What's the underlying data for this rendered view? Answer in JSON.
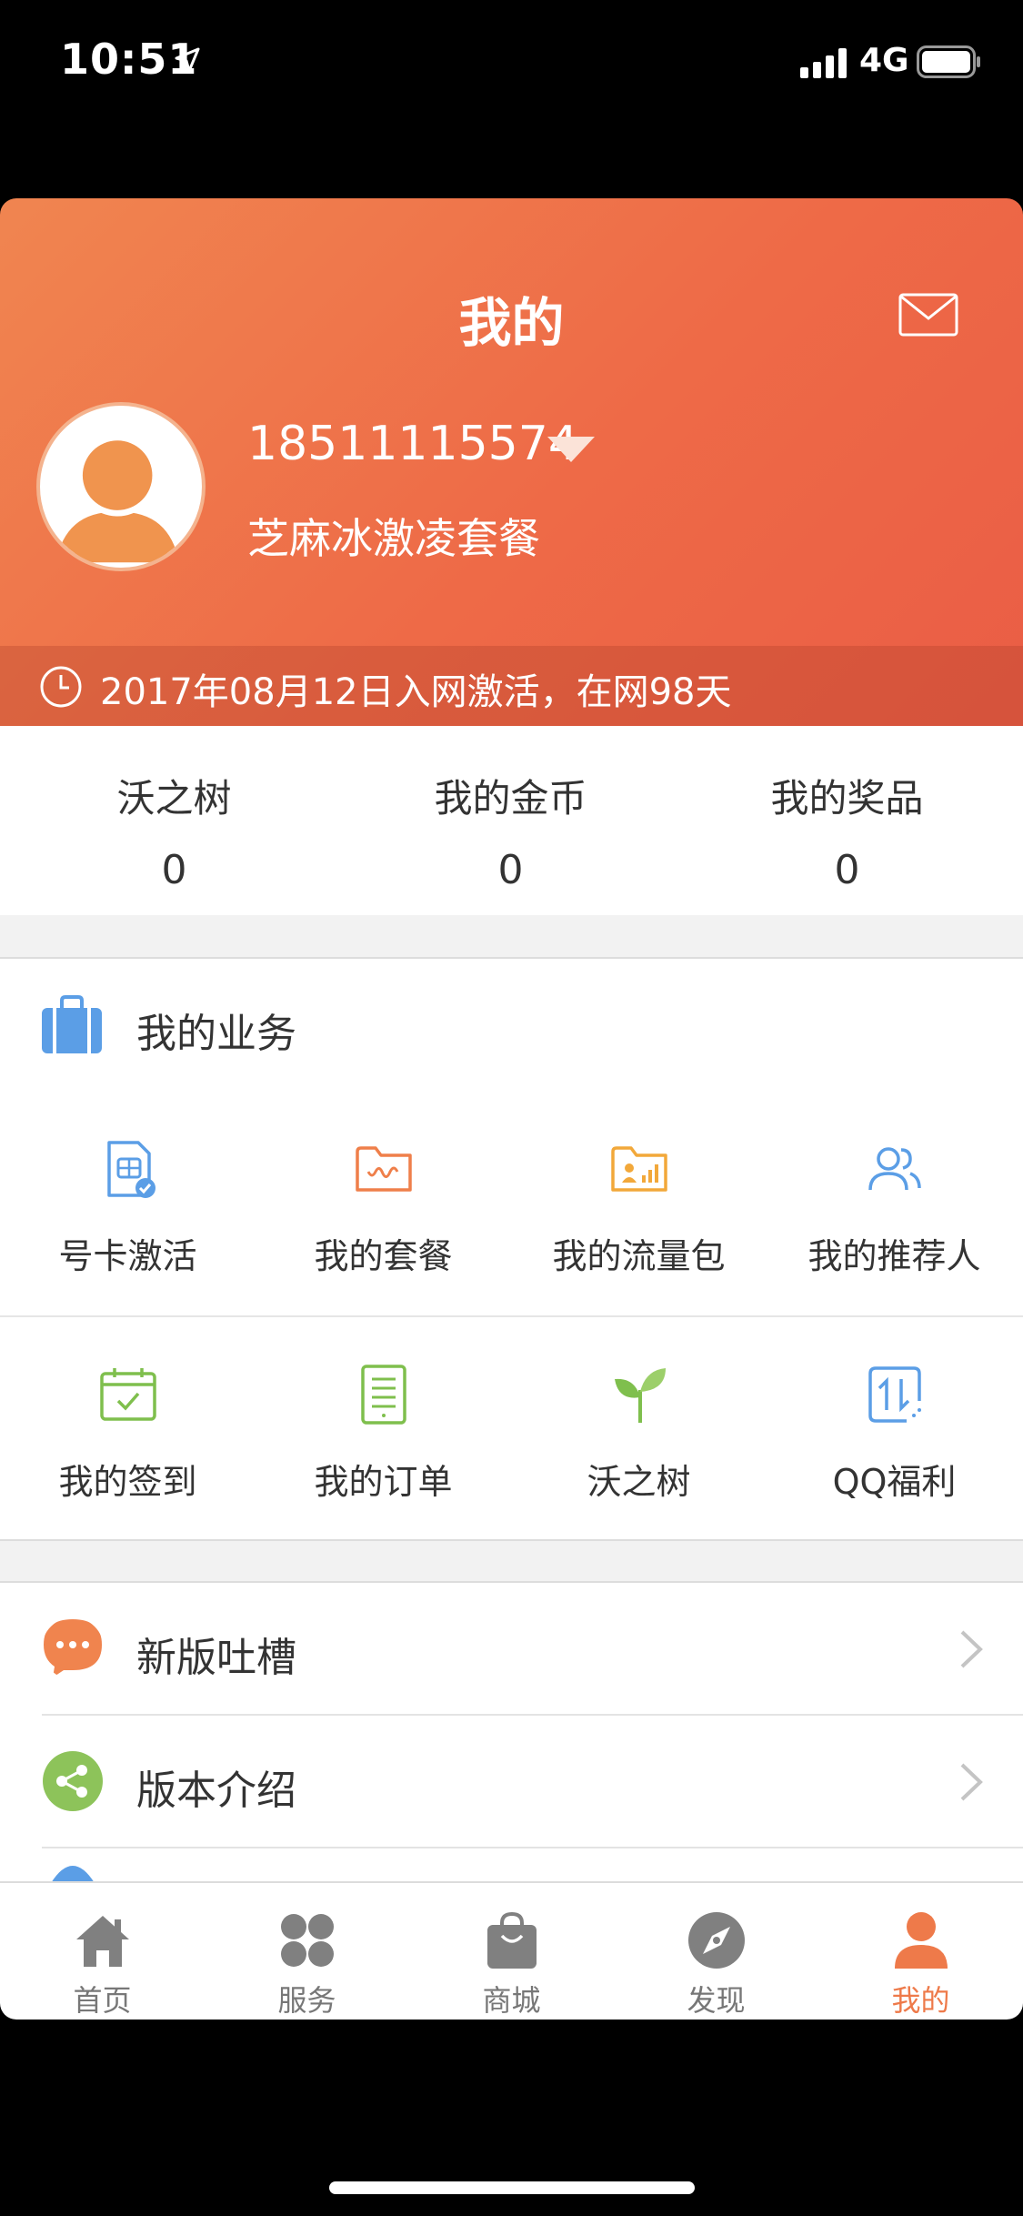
{
  "status_bar": {
    "time": "10:51",
    "network": "4G"
  },
  "header": {
    "title": "我的",
    "phone_number": "18511115574",
    "plan_name": "芝麻冰激凌套餐",
    "activation": "2017年08月12日入网激活，在网98天"
  },
  "stats": [
    {
      "label": "沃之树",
      "value": "0"
    },
    {
      "label": "我的金币",
      "value": "0"
    },
    {
      "label": "我的奖品",
      "value": "0"
    }
  ],
  "business": {
    "title": "我的业务",
    "items": [
      {
        "label": "号卡激活",
        "icon": "sim-card-icon"
      },
      {
        "label": "我的套餐",
        "icon": "plan-folder-icon"
      },
      {
        "label": "我的流量包",
        "icon": "data-pack-icon"
      },
      {
        "label": "我的推荐人",
        "icon": "referrer-icon"
      },
      {
        "label": "我的签到",
        "icon": "calendar-check-icon"
      },
      {
        "label": "我的订单",
        "icon": "order-list-icon"
      },
      {
        "label": "沃之树",
        "icon": "sprout-icon"
      },
      {
        "label": "QQ福利",
        "icon": "qq-data-icon"
      }
    ]
  },
  "list": [
    {
      "label": "新版吐槽",
      "icon": "chat-bubble-icon",
      "color": "#f0844e"
    },
    {
      "label": "版本介绍",
      "icon": "share-icon",
      "color": "#8dc35a"
    }
  ],
  "tabs": [
    {
      "label": "首页",
      "icon": "home-icon",
      "active": false
    },
    {
      "label": "服务",
      "icon": "services-grid-icon",
      "active": false
    },
    {
      "label": "商城",
      "icon": "shopping-bag-icon",
      "active": false
    },
    {
      "label": "发现",
      "icon": "compass-icon",
      "active": false
    },
    {
      "label": "我的",
      "icon": "profile-icon",
      "active": true
    }
  ],
  "colors": {
    "accent": "#ee7a4a",
    "header_start": "#f08550",
    "header_end": "#ea5d45",
    "blue_icon": "#5b9ee6",
    "orange_icon": "#ef7f4a",
    "yellow_icon": "#f2a83a",
    "green_icon": "#7fbf4d",
    "tab_inactive": "#888888"
  }
}
